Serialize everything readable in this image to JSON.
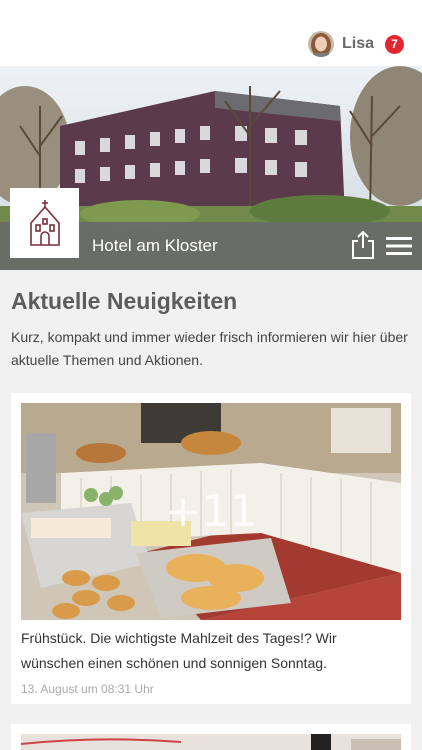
{
  "header": {
    "user_name": "Lisa",
    "notification_count": "7",
    "avatar_icon": "user-avatar",
    "badge_color": "#e3262f"
  },
  "hero": {
    "hotel_name": "Hotel am Kloster",
    "logo_icon": "church-icon",
    "share_icon": "share-icon",
    "menu_icon": "hamburger-menu-icon"
  },
  "section": {
    "title": "Aktuelle Neuigkeiten",
    "intro": "Kurz, kompakt und immer wieder frisch informieren wir hier über aktuelle Themen und Aktionen."
  },
  "posts": [
    {
      "image_count": "+11",
      "text": "Frühstück. Die wichtigste Mahlzeit des Tages!? Wir wünschen einen schönen und sonnigen Sonntag.",
      "date": "13. August um 08:31 Uhr"
    }
  ]
}
